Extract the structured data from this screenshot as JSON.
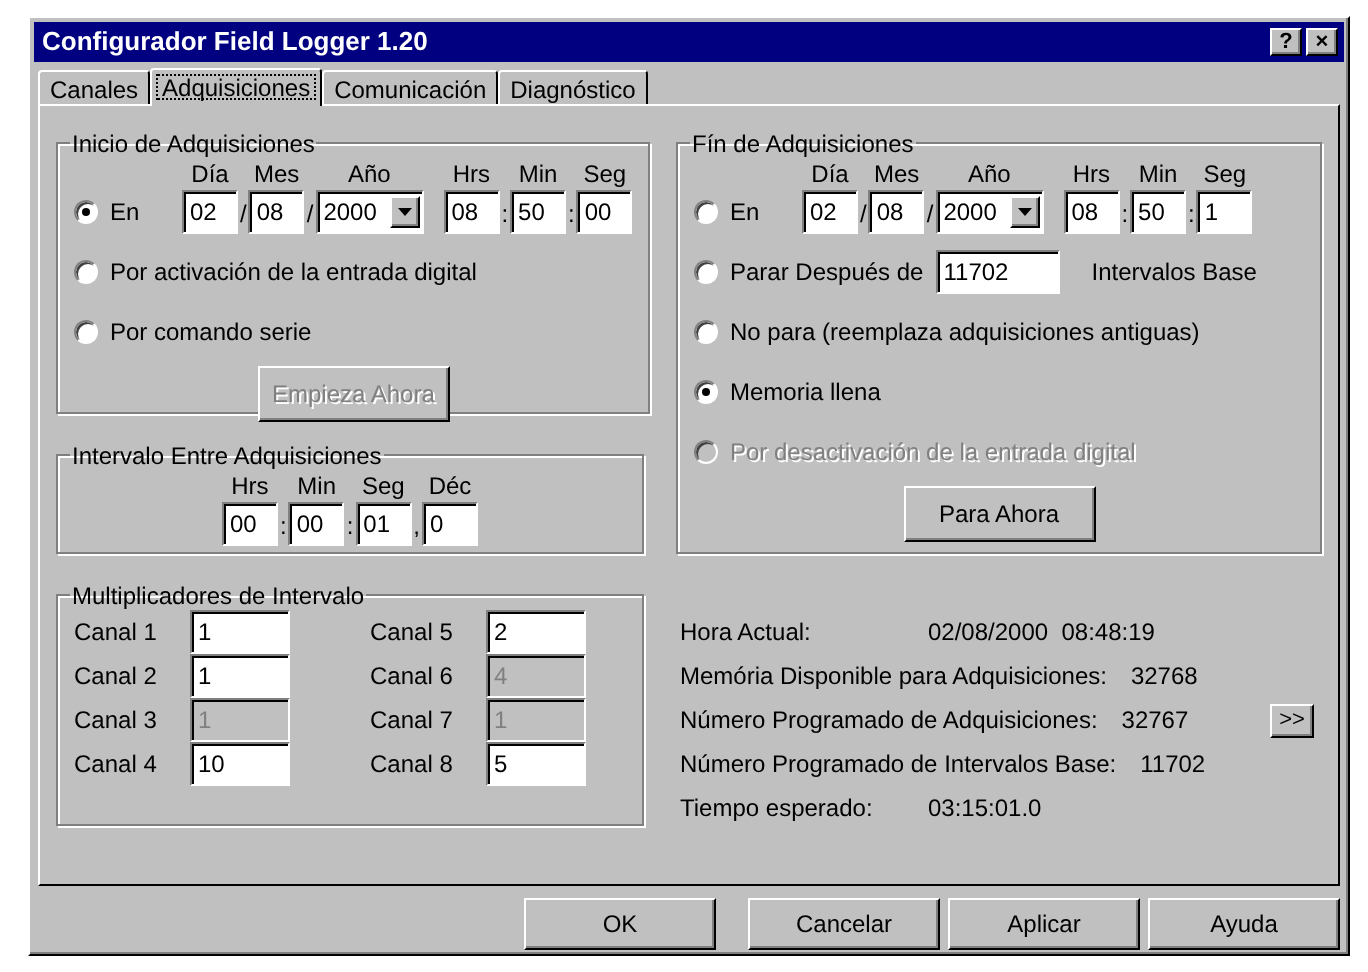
{
  "window": {
    "title": "Configurador Field Logger 1.20",
    "title_buttons": [
      "?",
      "×"
    ]
  },
  "tabs": [
    {
      "label": "Canales",
      "selected": false
    },
    {
      "label": "Adquisiciones",
      "selected": true
    },
    {
      "label": "Comunicación",
      "selected": false
    },
    {
      "label": "Diagnóstico",
      "selected": false
    }
  ],
  "start_group": {
    "title": "Inicio de Adquisiciones",
    "date_headers": [
      "Día",
      "Mes",
      "Año"
    ],
    "time_headers": [
      "Hrs",
      "Min",
      "Seg"
    ],
    "date_separator": "/",
    "time_separator": ":",
    "options": [
      {
        "kind": "datetime",
        "label": "En",
        "selected": true,
        "disabled": false,
        "date": [
          "02",
          "08",
          "2000"
        ],
        "time": [
          "08",
          "50",
          "00"
        ]
      },
      {
        "kind": "plain",
        "label": "Por activación de la entrada digital",
        "selected": false,
        "disabled": false
      },
      {
        "kind": "plain",
        "label": "Por comando serie",
        "selected": false,
        "disabled": false
      }
    ],
    "button": {
      "label": "Empieza Ahora",
      "disabled": true
    }
  },
  "interval_group": {
    "title": "Intervalo Entre Adquisiciones",
    "headers": [
      "Hrs",
      "Min",
      "Seg",
      "Déc"
    ],
    "values": [
      "00",
      "00",
      "01",
      "0"
    ],
    "separators": [
      ":",
      ":",
      ","
    ]
  },
  "multipliers": {
    "title": "Multiplicadores de Intervalo",
    "channels": [
      {
        "label": "Canal 1",
        "value": "1",
        "disabled": false
      },
      {
        "label": "Canal 2",
        "value": "1",
        "disabled": false
      },
      {
        "label": "Canal 3",
        "value": "1",
        "disabled": true
      },
      {
        "label": "Canal 4",
        "value": "10",
        "disabled": false
      },
      {
        "label": "Canal 5",
        "value": "2",
        "disabled": false
      },
      {
        "label": "Canal 6",
        "value": "4",
        "disabled": true
      },
      {
        "label": "Canal 7",
        "value": "1",
        "disabled": true
      },
      {
        "label": "Canal 8",
        "value": "5",
        "disabled": false
      }
    ]
  },
  "end_group": {
    "title": "Fín de Adquisiciones",
    "date_headers": [
      "Día",
      "Mes",
      "Año"
    ],
    "time_headers": [
      "Hrs",
      "Min",
      "Seg"
    ],
    "date_separator": "/",
    "time_separator": ":",
    "options": [
      {
        "kind": "datetime",
        "label": "En",
        "selected": false,
        "disabled": false,
        "date": [
          "02",
          "08",
          "2000"
        ],
        "time": [
          "08",
          "50",
          "1"
        ]
      },
      {
        "kind": "count",
        "label": "Parar Después de",
        "selected": false,
        "disabled": false,
        "value": "11702",
        "suffix": "Intervalos Base"
      },
      {
        "kind": "plain",
        "label": "No para (reemplaza adquisiciones antiguas)",
        "selected": false,
        "disabled": false
      },
      {
        "kind": "plain",
        "label": "Memoria llena",
        "selected": true,
        "disabled": false
      },
      {
        "kind": "plain",
        "label": "Por desactivación de la entrada digital",
        "selected": false,
        "disabled": true
      }
    ],
    "button": {
      "label": "Para Ahora",
      "disabled": false
    }
  },
  "info": [
    {
      "label": "Hora Actual:",
      "value": "02/08/2000  08:48:19"
    },
    {
      "label": "Memória Disponible para Adquisiciones:",
      "value": "32768"
    },
    {
      "label": "Número Programado de Adquisiciones:",
      "value": "32767",
      "button": ">>"
    },
    {
      "label": "Número Programado de Intervalos Base:",
      "value": "11702"
    },
    {
      "label": "Tiempo esperado:",
      "value": "03:15:01.0"
    }
  ],
  "buttons": [
    "OK",
    "Cancelar",
    "Aplicar",
    "Ayuda"
  ]
}
